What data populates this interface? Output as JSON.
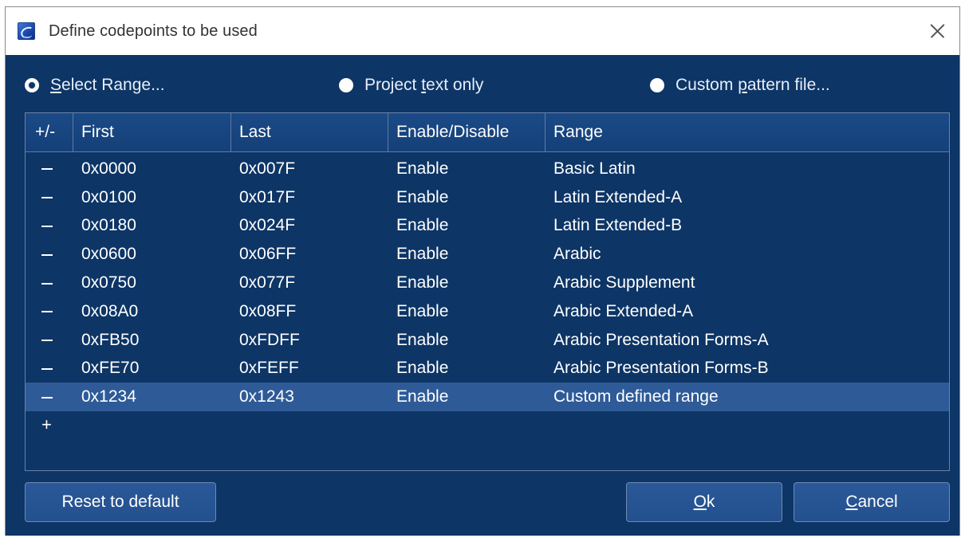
{
  "window": {
    "title": "Define codepoints to be used",
    "close_label": "✕"
  },
  "options": {
    "select_range": {
      "label_u": "S",
      "label_rest": "elect Range...",
      "selected": true
    },
    "project_text": {
      "label_pre": "Project ",
      "label_u": "t",
      "label_rest": "ext only",
      "selected": false
    },
    "custom_pattern": {
      "label_pre": "Custom ",
      "label_u": "p",
      "label_rest": "attern file...",
      "selected": false
    }
  },
  "table": {
    "headers": [
      "+/-",
      "First",
      "Last",
      "Enable/Disable",
      "Range"
    ],
    "rows": [
      {
        "first": "0x0000",
        "last": "0x007F",
        "state": "Enable",
        "range": "Basic Latin"
      },
      {
        "first": "0x0100",
        "last": "0x017F",
        "state": "Enable",
        "range": "Latin Extended-A"
      },
      {
        "first": "0x0180",
        "last": "0x024F",
        "state": "Enable",
        "range": "Latin Extended-B"
      },
      {
        "first": "0x0600",
        "last": "0x06FF",
        "state": "Enable",
        "range": "Arabic"
      },
      {
        "first": "0x0750",
        "last": "0x077F",
        "state": "Enable",
        "range": "Arabic Supplement"
      },
      {
        "first": "0x08A0",
        "last": "0x08FF",
        "state": "Enable",
        "range": "Arabic Extended-A"
      },
      {
        "first": "0xFB50",
        "last": "0xFDFF",
        "state": "Enable",
        "range": "Arabic Presentation Forms-A"
      },
      {
        "first": "0xFE70",
        "last": "0xFEFF",
        "state": "Enable",
        "range": "Arabic Presentation Forms-B"
      },
      {
        "first": "0x1234",
        "last": "0x1243",
        "state": "Enable",
        "range": "Custom defined range"
      }
    ],
    "selected_row": 8,
    "add_label": "+"
  },
  "buttons": {
    "reset": "Reset to default",
    "ok_u": "O",
    "ok_rest": "k",
    "cancel_u": "C",
    "cancel_rest": "ancel"
  },
  "colors": {
    "client_bg": "#0d3566",
    "header_bg": "#1a4a86",
    "selected_row_bg": "#2e5b98",
    "button_bg": "#2a5898"
  }
}
